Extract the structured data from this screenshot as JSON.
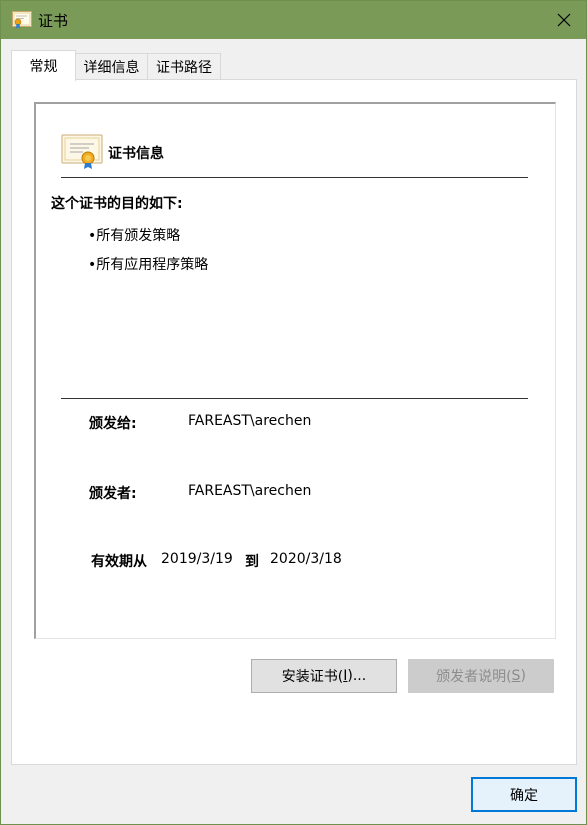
{
  "window": {
    "title": "证书"
  },
  "tabs": [
    {
      "label": "常规"
    },
    {
      "label": "详细信息"
    },
    {
      "label": "证书路径"
    }
  ],
  "cert_info": {
    "heading": "证书信息",
    "purpose_title": "这个证书的目的如下:",
    "purposes": [
      "•所有颁发策略",
      "•所有应用程序策略"
    ]
  },
  "fields": {
    "issued_to_label": "颁发给:",
    "issued_to_value": "FAREAST\\arechen",
    "issued_by_label": "颁发者:",
    "issued_by_value": "FAREAST\\arechen",
    "valid_label": "有效期从",
    "valid_from": "2019/3/19",
    "to_label": "到",
    "valid_to": "2020/3/18"
  },
  "buttons": {
    "install": {
      "text": "安装证书(",
      "key": "I",
      "suffix": ")..."
    },
    "issuer_statement": {
      "text": "颁发者说明(",
      "key": "S",
      "suffix": ")"
    },
    "ok": "确定"
  },
  "icons": {
    "title_icon": "certificate-icon",
    "close": "close-icon",
    "cert": "certificate-icon"
  }
}
